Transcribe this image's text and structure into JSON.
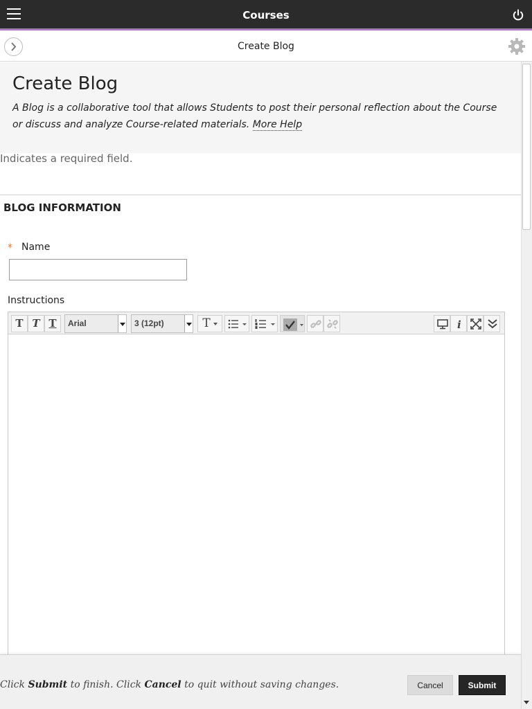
{
  "topbar": {
    "title": "Courses",
    "menu_icon": "hamburger-icon",
    "power_icon": "power-icon"
  },
  "subbar": {
    "title": "Create Blog",
    "back_icon": "chevron-right-icon",
    "settings_icon": "gear-icon"
  },
  "header": {
    "title": "Create Blog",
    "description": "A Blog is a collaborative tool that allows Students to post their personal reflection about the Course or discuss and analyze Course-related materials.",
    "more_help": "More Help"
  },
  "required_note": "Indicates a required field.",
  "section": {
    "title": "BLOG INFORMATION"
  },
  "name_field": {
    "required_marker": "*",
    "label": "Name",
    "value": "",
    "placeholder": ""
  },
  "instructions": {
    "label": "Instructions",
    "toolbar": {
      "bold": "T",
      "italic": "T",
      "underline": "T",
      "font_family": "Arial",
      "font_size": "3 (12pt)",
      "text_color": "T"
    }
  },
  "footer": {
    "note_click": "Click",
    "note_submit": "Submit",
    "note_mid": "to finish. Click",
    "note_cancel": "Cancel",
    "note_end": "to quit without saving changes.",
    "cancel_label": "Cancel",
    "submit_label": "Submit"
  },
  "colors": {
    "accent": "#b36fd1",
    "topbar": "#2b2b2b",
    "required": "#e87422",
    "submit_bg": "#262626"
  }
}
